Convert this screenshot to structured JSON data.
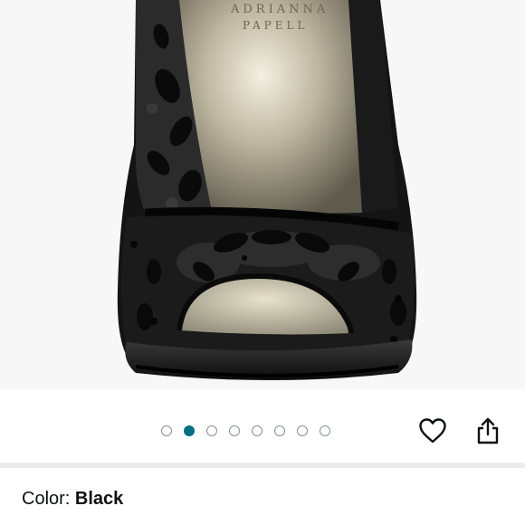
{
  "gallery": {
    "image_count": 8,
    "active_index": 1,
    "brand_text_upper": "ADRIANNA",
    "brand_text_lower": "PAPELL"
  },
  "actions": {
    "favorite_icon": "heart-icon",
    "share_icon": "share-icon"
  },
  "color": {
    "label": "Color: ",
    "value": "Black"
  },
  "colors": {
    "accent": "#007185",
    "dot_border": "#8a8f94",
    "divider": "#eaeded",
    "text": "#0f1111"
  }
}
